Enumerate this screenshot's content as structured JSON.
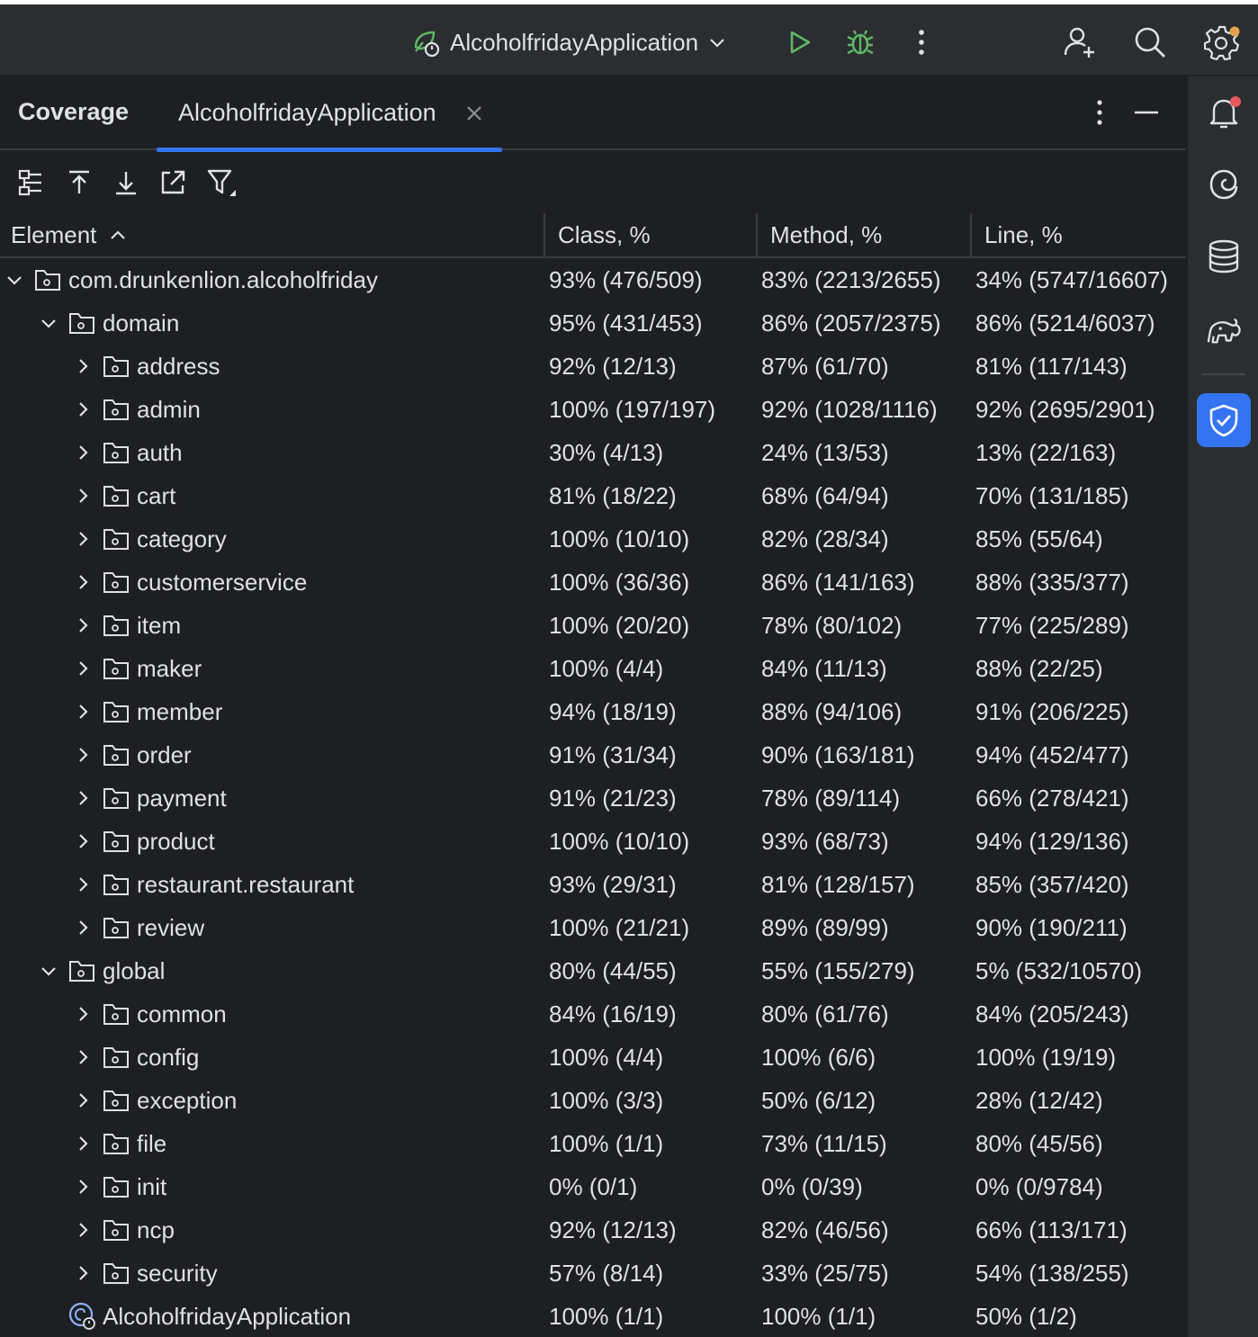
{
  "topbar": {
    "run_config_label": "AlcoholfridayApplication",
    "icons": [
      "spring-run-config-icon",
      "chevron-down-icon",
      "run-icon",
      "debug-icon",
      "more-vertical-icon",
      "add-user-icon",
      "search-icon",
      "settings-icon"
    ],
    "accent_green": "#5fb865",
    "badge_orange": "#e5a44c"
  },
  "right_stripe": {
    "icons": [
      "notifications-icon",
      "ai-assistant-icon",
      "database-icon",
      "gradle-elephant-icon",
      "coverage-shield-icon"
    ],
    "active_color": "#3574f0",
    "badge_red": "#e55b5b"
  },
  "panel": {
    "title": "Coverage",
    "tab_label": "AlcoholfridayApplication"
  },
  "table": {
    "columns": [
      "Element",
      "Class, %",
      "Method, %",
      "Line, %"
    ],
    "rows": [
      {
        "level": 0,
        "expanded": true,
        "type": "folder",
        "name": "com.drunkenlion.alcoholfriday",
        "class": "93% (476/509)",
        "method": "83% (2213/2655)",
        "line": "34% (5747/16607)"
      },
      {
        "level": 1,
        "expanded": true,
        "type": "folder",
        "name": "domain",
        "class": "95% (431/453)",
        "method": "86% (2057/2375)",
        "line": "86% (5214/6037)"
      },
      {
        "level": 2,
        "expanded": false,
        "type": "folder",
        "name": "address",
        "class": "92% (12/13)",
        "method": "87% (61/70)",
        "line": "81% (117/143)"
      },
      {
        "level": 2,
        "expanded": false,
        "type": "folder",
        "name": "admin",
        "class": "100% (197/197)",
        "method": "92% (1028/1116)",
        "line": "92% (2695/2901)"
      },
      {
        "level": 2,
        "expanded": false,
        "type": "folder",
        "name": "auth",
        "class": "30% (4/13)",
        "method": "24% (13/53)",
        "line": "13% (22/163)"
      },
      {
        "level": 2,
        "expanded": false,
        "type": "folder",
        "name": "cart",
        "class": "81% (18/22)",
        "method": "68% (64/94)",
        "line": "70% (131/185)"
      },
      {
        "level": 2,
        "expanded": false,
        "type": "folder",
        "name": "category",
        "class": "100% (10/10)",
        "method": "82% (28/34)",
        "line": "85% (55/64)"
      },
      {
        "level": 2,
        "expanded": false,
        "type": "folder",
        "name": "customerservice",
        "class": "100% (36/36)",
        "method": "86% (141/163)",
        "line": "88% (335/377)"
      },
      {
        "level": 2,
        "expanded": false,
        "type": "folder",
        "name": "item",
        "class": "100% (20/20)",
        "method": "78% (80/102)",
        "line": "77% (225/289)"
      },
      {
        "level": 2,
        "expanded": false,
        "type": "folder",
        "name": "maker",
        "class": "100% (4/4)",
        "method": "84% (11/13)",
        "line": "88% (22/25)"
      },
      {
        "level": 2,
        "expanded": false,
        "type": "folder",
        "name": "member",
        "class": "94% (18/19)",
        "method": "88% (94/106)",
        "line": "91% (206/225)"
      },
      {
        "level": 2,
        "expanded": false,
        "type": "folder",
        "name": "order",
        "class": "91% (31/34)",
        "method": "90% (163/181)",
        "line": "94% (452/477)"
      },
      {
        "level": 2,
        "expanded": false,
        "type": "folder",
        "name": "payment",
        "class": "91% (21/23)",
        "method": "78% (89/114)",
        "line": "66% (278/421)"
      },
      {
        "level": 2,
        "expanded": false,
        "type": "folder",
        "name": "product",
        "class": "100% (10/10)",
        "method": "93% (68/73)",
        "line": "94% (129/136)"
      },
      {
        "level": 2,
        "expanded": false,
        "type": "folder",
        "name": "restaurant.restaurant",
        "class": "93% (29/31)",
        "method": "81% (128/157)",
        "line": "85% (357/420)"
      },
      {
        "level": 2,
        "expanded": false,
        "type": "folder",
        "name": "review",
        "class": "100% (21/21)",
        "method": "89% (89/99)",
        "line": "90% (190/211)"
      },
      {
        "level": 1,
        "expanded": true,
        "type": "folder",
        "name": "global",
        "class": "80% (44/55)",
        "method": "55% (155/279)",
        "line": "5% (532/10570)"
      },
      {
        "level": 2,
        "expanded": false,
        "type": "folder",
        "name": "common",
        "class": "84% (16/19)",
        "method": "80% (61/76)",
        "line": "84% (205/243)"
      },
      {
        "level": 2,
        "expanded": false,
        "type": "folder",
        "name": "config",
        "class": "100% (4/4)",
        "method": "100% (6/6)",
        "line": "100% (19/19)"
      },
      {
        "level": 2,
        "expanded": false,
        "type": "folder",
        "name": "exception",
        "class": "100% (3/3)",
        "method": "50% (6/12)",
        "line": "28% (12/42)"
      },
      {
        "level": 2,
        "expanded": false,
        "type": "folder",
        "name": "file",
        "class": "100% (1/1)",
        "method": "73% (11/15)",
        "line": "80% (45/56)"
      },
      {
        "level": 2,
        "expanded": false,
        "type": "folder",
        "name": "init",
        "class": "0% (0/1)",
        "method": "0% (0/39)",
        "line": "0% (0/9784)"
      },
      {
        "level": 2,
        "expanded": false,
        "type": "folder",
        "name": "ncp",
        "class": "92% (12/13)",
        "method": "82% (46/56)",
        "line": "66% (113/171)"
      },
      {
        "level": 2,
        "expanded": false,
        "type": "folder",
        "name": "security",
        "class": "57% (8/14)",
        "method": "33% (25/75)",
        "line": "54% (138/255)"
      },
      {
        "level": 1,
        "expanded": null,
        "type": "app-class",
        "name": "AlcoholfridayApplication",
        "class": "100% (1/1)",
        "method": "100% (1/1)",
        "line": "50% (1/2)"
      }
    ]
  }
}
